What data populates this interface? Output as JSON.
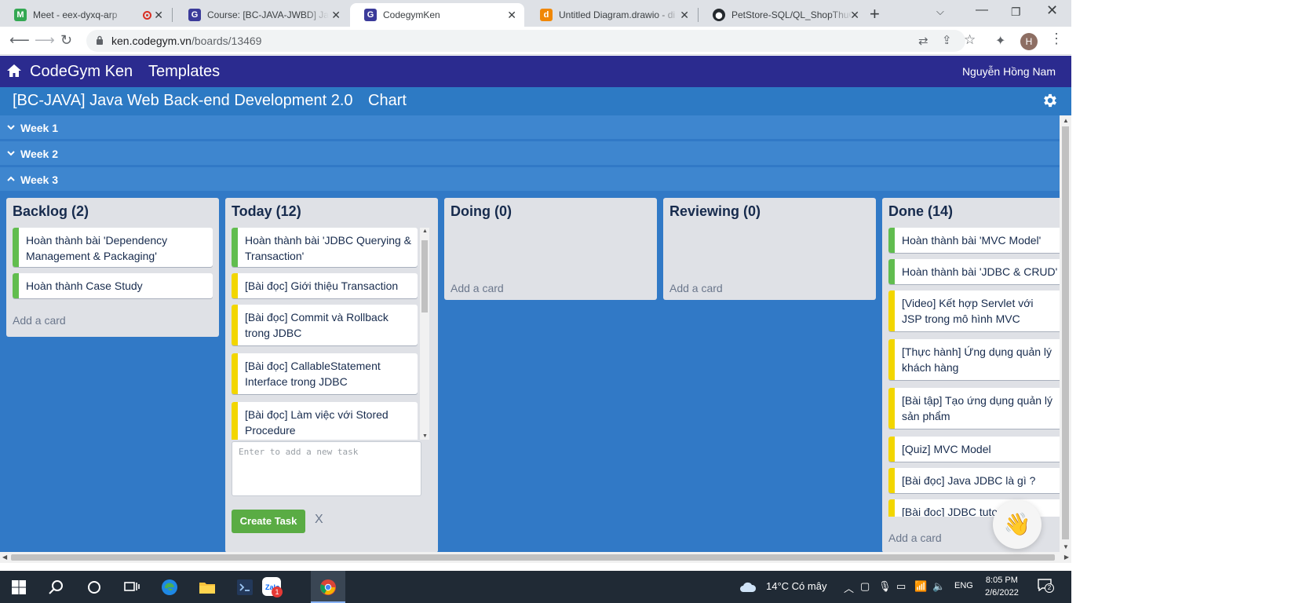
{
  "browser": {
    "tabs": [
      {
        "title": "Meet - eex-dyxq-arp",
        "favicon_color": "#34a853",
        "favicon_text": "M"
      },
      {
        "title": "Course: [BC-JAVA-JWBD] Java",
        "favicon_color": "#3b3b9a",
        "favicon_text": "G"
      },
      {
        "title": "CodegymKen",
        "favicon_color": "#3b3b9a",
        "favicon_text": "G"
      },
      {
        "title": "Untitled Diagram.drawio - di",
        "favicon_color": "#f08705",
        "favicon_text": "d"
      },
      {
        "title": "PetStore-SQL/QL_ShopThuCu",
        "favicon_color": "#24292e",
        "favicon_text": "⬤"
      }
    ],
    "url_host": "ken.codegym.vn",
    "url_path": "/boards/13469",
    "avatar_letter": "H"
  },
  "app": {
    "brand": "CodeGym Ken",
    "templates_label": "Templates",
    "user_name": "Nguyễn Hồng Nam"
  },
  "board": {
    "title": "[BC-JAVA] Java Web Back-end Development 2.0",
    "chart_label": "Chart",
    "weeks": [
      "Week 1",
      "Week 2",
      "Week 3"
    ],
    "lists": {
      "backlog": {
        "title": "Backlog (2)",
        "cards": [
          {
            "text": "Hoàn thành bài 'Dependency Management & Packaging'",
            "color": "#61bd4f"
          },
          {
            "text": "Hoàn thành Case Study",
            "color": "#61bd4f"
          }
        ],
        "add_label": "Add a card"
      },
      "today": {
        "title": "Today (12)",
        "cards": [
          {
            "text": "Hoàn thành bài 'JDBC Querying & Transaction'",
            "color": "#61bd4f"
          },
          {
            "text": "[Bài đọc] Giới thiệu Transaction",
            "color": "#f2d600"
          },
          {
            "text": "[Bài đọc] Commit và Rollback trong JDBC",
            "color": "#f2d600"
          },
          {
            "text": "[Bài đọc] CallableStatement Interface trong JDBC",
            "color": "#f2d600"
          },
          {
            "text": "[Bài đọc] Làm việc với Stored Procedure",
            "color": "#f2d600"
          }
        ],
        "task_placeholder": "Enter to add a new task",
        "create_label": "Create Task",
        "cancel_label": "X"
      },
      "doing": {
        "title": "Doing (0)",
        "add_label": "Add a card"
      },
      "reviewing": {
        "title": "Reviewing (0)",
        "add_label": "Add a card"
      },
      "done": {
        "title": "Done (14)",
        "cards": [
          {
            "text": "Hoàn thành bài 'MVC Model'",
            "color": "#61bd4f"
          },
          {
            "text": "Hoàn thành bài 'JDBC & CRUD'",
            "color": "#61bd4f"
          },
          {
            "text": "[Video] Kết hợp Servlet với JSP trong mô hình MVC",
            "color": "#f2d600"
          },
          {
            "text": "[Thực hành] Ứng dụng quản lý khách hàng",
            "color": "#f2d600"
          },
          {
            "text": "[Bài tập] Tạo ứng dụng quản lý sản phẩm",
            "color": "#f2d600"
          },
          {
            "text": "[Quiz] MVC Model",
            "color": "#f2d600"
          },
          {
            "text": "[Bài đọc] Java JDBC là gì ?",
            "color": "#f2d600"
          },
          {
            "text": "[Bài đọc] JDBC tutorial",
            "color": "#f2d600"
          }
        ],
        "add_label": "Add a card"
      }
    }
  },
  "taskbar": {
    "weather": "14°C  Có mây",
    "language": "ENG",
    "time": "8:05 PM",
    "date": "2/6/2022",
    "zalo_badge": "1",
    "notification_count": "2"
  }
}
